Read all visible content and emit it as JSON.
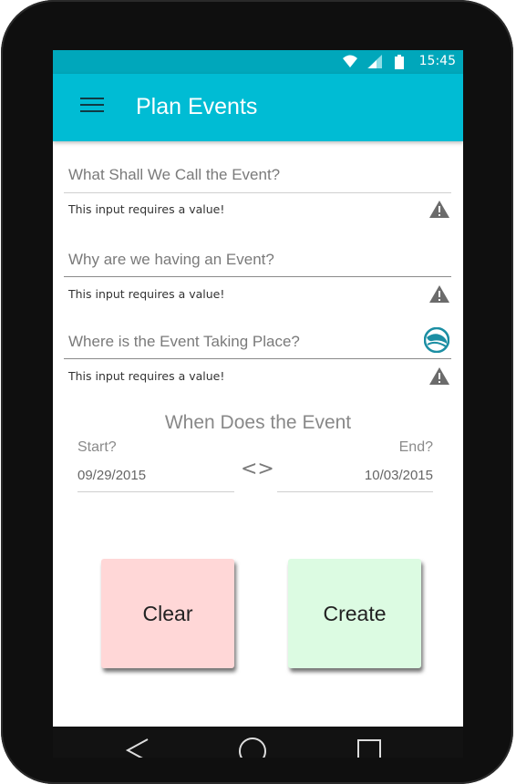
{
  "status_bar": {
    "time": "15:45"
  },
  "app_bar": {
    "title": "Plan Events"
  },
  "form": {
    "event_name": {
      "placeholder": "What Shall We Call the Event?",
      "error": "This input requires a value!"
    },
    "event_reason": {
      "placeholder": "Why are we having an Event?",
      "error": "This input requires a value!"
    },
    "event_location": {
      "placeholder": "Where is the Event Taking Place?",
      "error": "This input requires a value!"
    }
  },
  "when": {
    "title": "When Does the Event",
    "start_label": "Start?",
    "end_label": "End?",
    "start_date": "09/29/2015",
    "end_date": "10/03/2015",
    "separator": "<>"
  },
  "buttons": {
    "clear": "Clear",
    "create": "Create"
  },
  "colors": {
    "app_bar": "#00bcd4",
    "status_bar": "#00a7bb",
    "clear_bg": "#ffd7d7",
    "create_bg": "#dcfbe2"
  }
}
